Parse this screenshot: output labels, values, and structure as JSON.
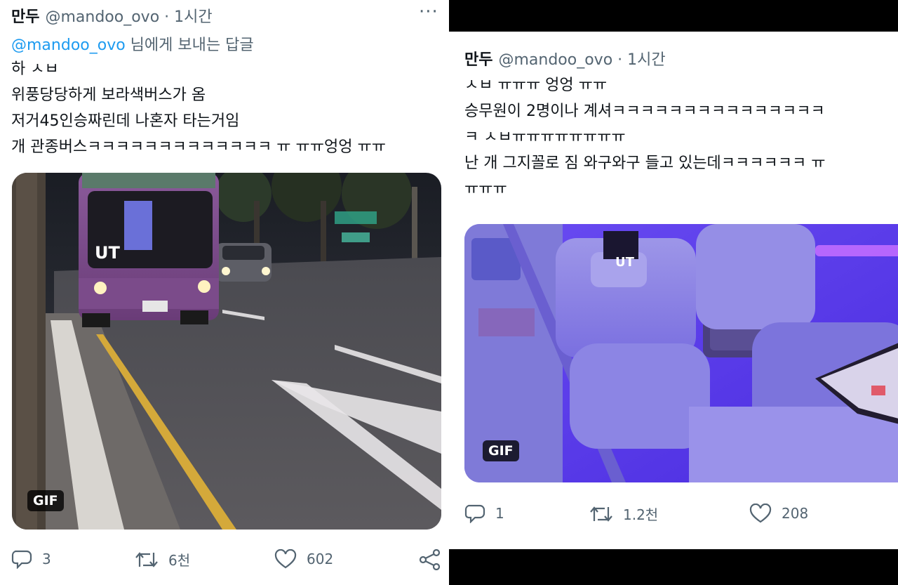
{
  "left_tweet": {
    "name": "만두",
    "handle": "@mandoo_ovo · 1시간",
    "more": "···",
    "reply_mention": "@mandoo_ovo",
    "reply_suffix": " 님에게 보내는 답글",
    "lines": [
      "하 ㅅㅂ",
      "위풍당당하게 보라색버스가 옴",
      "저거45인승짜린데 나혼자 타는거임",
      "개 관종버스ㅋㅋㅋㅋㅋㅋㅋㅋㅋㅋㅋㅋㅋ ㅠ ㅠㅠ엉엉 ㅠㅠ"
    ],
    "media_badge": "GIF",
    "bus_label": "UT",
    "replies": "3",
    "retweets": "6천",
    "likes": "602"
  },
  "right_tweet": {
    "name": "만두",
    "handle": "@mandoo_ovo · 1시간",
    "lines": [
      "ㅅㅂ ㅠㅠㅠ 엉엉 ㅠㅠ",
      "승무원이 2명이나 계셔ㅋㅋㅋㅋㅋㅋㅋㅋㅋㅋㅋㅋㅋㅋㅋ",
      "ㅋ ㅅㅂㅠㅠㅠㅠㅠㅠㅠㅠ",
      "난 개 그지꼴로 짐 와구와구 들고 있는데ㅋㅋㅋㅋㅋㅋ ㅠ",
      "ㅠㅠㅠ"
    ],
    "media_badge": "GIF",
    "seat_label": "UT",
    "replies": "1",
    "retweets": "1.2천",
    "likes": "208"
  },
  "colors": {
    "text": "#0f1419",
    "muted": "#536471",
    "mention": "#1d9bf0",
    "bus_purple": "#7a4a8a",
    "interior_purple": "#5b3cf0"
  },
  "icons": [
    "more-icon",
    "reply-icon",
    "retweet-icon",
    "like-icon",
    "share-icon"
  ]
}
